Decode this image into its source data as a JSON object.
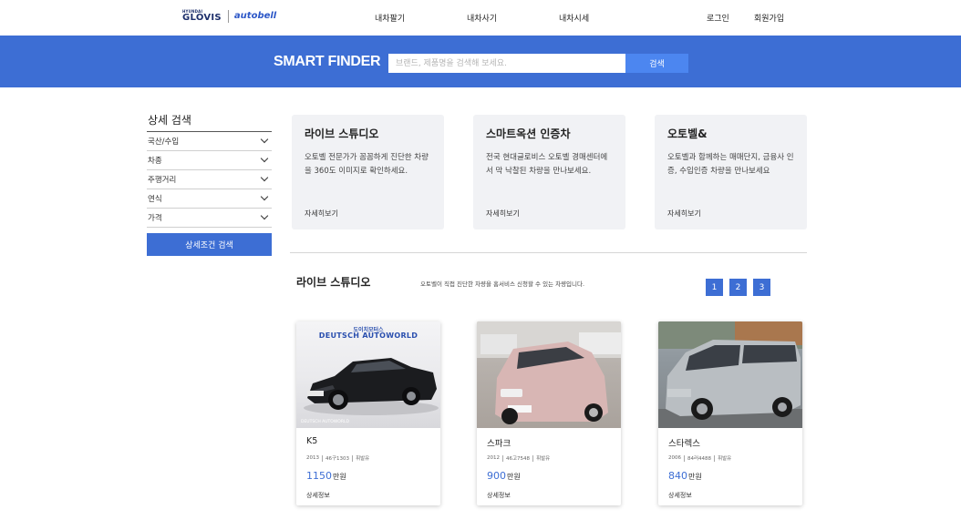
{
  "header": {
    "logo": {
      "brand1_small": "HYUNDAI",
      "brand1": "GLOVIS",
      "brand2": "autobell"
    },
    "nav": [
      "내차팔기",
      "내차사기",
      "내차시세"
    ],
    "auth": {
      "login": "로그인",
      "signup": "회원가입"
    }
  },
  "search": {
    "title": "SMART FINDER",
    "placeholder": "브랜드, 제품명을 검색해 보세요.",
    "button": "검색"
  },
  "sidebar": {
    "title": "상세 검색",
    "filters": [
      "국산/수입",
      "차종",
      "주행거리",
      "연식",
      "가격"
    ],
    "button": "상세조건 검색"
  },
  "info_cards": [
    {
      "title": "라이브 스튜디오",
      "desc": "오토벨 전문가가 꼼꼼하게 진단한 차량을 360도 이미지로 확인하세요.",
      "more": "자세히보기"
    },
    {
      "title": "스마트옥션 인증차",
      "desc": "전국 현대글로비스 오토벨 경매센터에서 막 낙찰된 차량을 만나보세요.",
      "more": "자세히보기"
    },
    {
      "title": "오토벨&",
      "desc": "오토벨과 함께하는 매매단지, 금융사 인증, 수입인증 차량을 만나보세요",
      "more": "자세히보기"
    }
  ],
  "section": {
    "title": "라이브 스튜디오",
    "desc": "오토벨이 직접 진단한 차량을 홈서비스 신청할 수 있는 차량입니다.",
    "pages": [
      "1",
      "2",
      "3"
    ]
  },
  "cars": [
    {
      "name": "K5",
      "year": "2013",
      "plate": "46구1303",
      "fuel": "휘발유",
      "price": "1150",
      "unit": "만원",
      "more": "상세정보",
      "watermark_top": "도이치모터스",
      "watermark": "DEUTSCH AUTOWORLD",
      "watermark_bottom": "DEUTSCH AUTOWORLD",
      "color": "#1b1c1f"
    },
    {
      "name": "스파크",
      "year": "2012",
      "plate": "46고7548",
      "fuel": "휘발유",
      "price": "900",
      "unit": "만원",
      "more": "상세정보",
      "color": "#d8b6b4"
    },
    {
      "name": "스타렉스",
      "year": "2006",
      "plate": "84러4488",
      "fuel": "휘발유",
      "price": "840",
      "unit": "만원",
      "more": "상세정보",
      "color": "#b9bec2"
    }
  ],
  "colors": {
    "accent": "#3d6ed4",
    "search_button": "#4c86f0",
    "card_bg": "#f1f2f5"
  }
}
